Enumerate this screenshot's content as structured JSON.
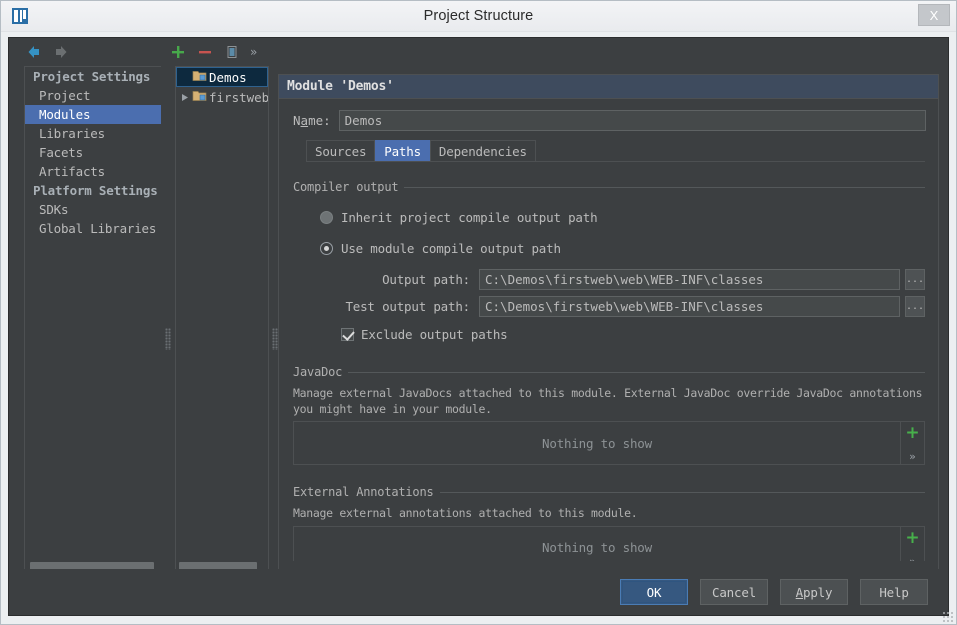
{
  "window": {
    "title": "Project Structure",
    "close_label": "X",
    "logo_icon": "intellij-idea-logo"
  },
  "toolbar": {
    "back_icon": "arrow-left-icon",
    "forward_icon": "arrow-right-icon",
    "add_icon": "plus-icon",
    "remove_icon": "minus-icon",
    "copy_icon": "copy-icon",
    "more_label": "»"
  },
  "sidebar": {
    "sections": [
      {
        "title": "Project Settings",
        "items": [
          {
            "label": "Project",
            "selected": false
          },
          {
            "label": "Modules",
            "selected": true
          },
          {
            "label": "Libraries",
            "selected": false
          },
          {
            "label": "Facets",
            "selected": false
          },
          {
            "label": "Artifacts",
            "selected": false
          }
        ]
      },
      {
        "title": "Platform Settings",
        "items": [
          {
            "label": "SDKs",
            "selected": false
          },
          {
            "label": "Global Libraries",
            "selected": false
          }
        ]
      }
    ]
  },
  "module_tree": {
    "nodes": [
      {
        "label": "Demos",
        "selected": true,
        "expandable": false,
        "icon": "module-folder-icon"
      },
      {
        "label": "firstweb",
        "selected": false,
        "expandable": true,
        "icon": "module-folder-icon"
      }
    ]
  },
  "content": {
    "header": "Module 'Demos'",
    "name_label": "Name:",
    "name_label_prefix": "N",
    "name_label_mnemonic": "a",
    "name_label_suffix": "me:",
    "name_value": "Demos",
    "tabs": [
      {
        "label": "Sources",
        "active": false
      },
      {
        "label": "Paths",
        "active": true
      },
      {
        "label": "Dependencies",
        "active": false
      }
    ],
    "compiler_output": {
      "legend": "Compiler output",
      "options": [
        {
          "label": "Inherit project compile output path",
          "selected": false
        },
        {
          "label": "Use module compile output path",
          "selected": true
        }
      ],
      "fields": [
        {
          "label": "Output path:",
          "value": "C:\\Demos\\firstweb\\web\\WEB-INF\\classes",
          "browse_label": "..."
        },
        {
          "label": "Test output path:",
          "value": "C:\\Demos\\firstweb\\web\\WEB-INF\\classes",
          "browse_label": "..."
        }
      ],
      "exclude_checkbox": {
        "label": "Exclude output paths",
        "checked": true
      }
    },
    "javadoc": {
      "legend": "JavaDoc",
      "description": "Manage external JavaDocs attached to this module. External JavaDoc override JavaDoc annotations you might have in your module.",
      "empty_text": "Nothing to show",
      "add_label": "+",
      "more_label": "»"
    },
    "external_annotations": {
      "legend": "External Annotations",
      "description": "Manage external annotations attached to this module.",
      "empty_text": "Nothing to show",
      "add_label": "+",
      "more_label": "»"
    }
  },
  "buttons": [
    {
      "label": "OK",
      "default": true,
      "mnemonic": ""
    },
    {
      "label": "Cancel",
      "default": false,
      "mnemonic": ""
    },
    {
      "label": "Apply",
      "default": false,
      "mnemonic": "A"
    },
    {
      "label": "Help",
      "default": false,
      "mnemonic": ""
    }
  ],
  "colors": {
    "dialog_bg": "#3c3f41",
    "selection_blue": "#4b6eaf",
    "tree_selection": "#0d293e",
    "default_button": "#365880",
    "accent_green": "#47b04b",
    "header_bar": "#3e4b5e"
  }
}
